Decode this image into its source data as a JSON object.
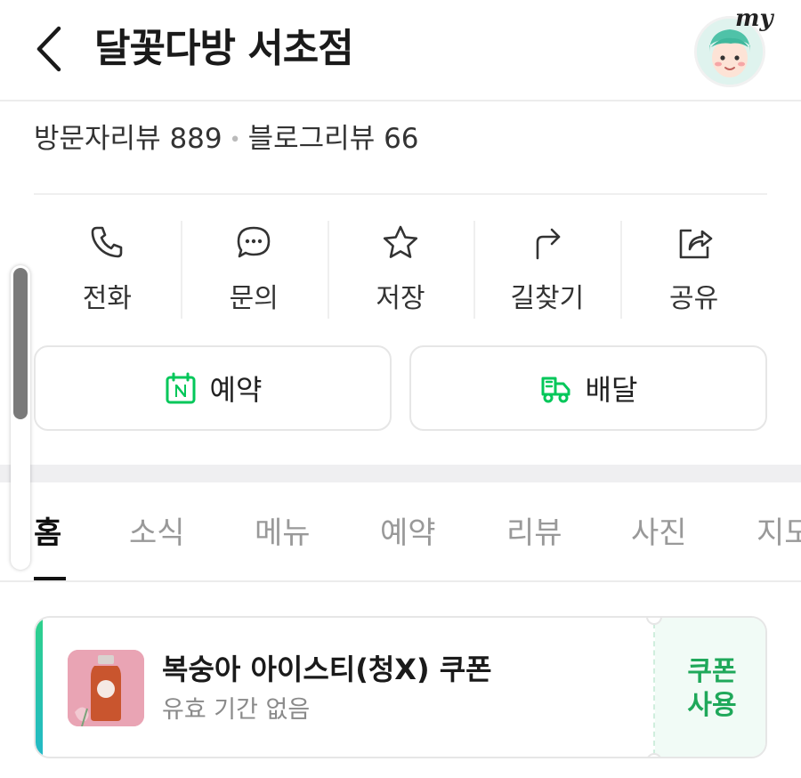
{
  "header": {
    "title": "달꽃다방 서초점",
    "my_label": "my"
  },
  "reviews": {
    "visitor": "방문자리뷰 889",
    "separator": "•",
    "blog": "블로그리뷰 66"
  },
  "actions": [
    {
      "label": "전화",
      "icon": "phone-icon"
    },
    {
      "label": "문의",
      "icon": "chat-bubble-icon"
    },
    {
      "label": "저장",
      "icon": "star-icon"
    },
    {
      "label": "길찾기",
      "icon": "directions-arrow-icon"
    },
    {
      "label": "공유",
      "icon": "share-icon"
    }
  ],
  "buttons": {
    "reserve_label": "예약",
    "delivery_label": "배달"
  },
  "tabs": [
    {
      "label": "홈",
      "active": true
    },
    {
      "label": "소식",
      "active": false
    },
    {
      "label": "메뉴",
      "active": false
    },
    {
      "label": "예약",
      "active": false
    },
    {
      "label": "리뷰",
      "active": false
    },
    {
      "label": "사진",
      "active": false
    },
    {
      "label": "지도",
      "active": false
    }
  ],
  "coupon": {
    "title": "복숭아 아이스티(청X) 쿠폰",
    "subtitle": "유효 기간 없음",
    "use_line1": "쿠폰",
    "use_line2": "사용"
  },
  "colors": {
    "brand_green": "#03c75a",
    "coupon_accent": "#2ed18a",
    "text_dark": "#1a1a1a",
    "text_muted": "#999999"
  }
}
